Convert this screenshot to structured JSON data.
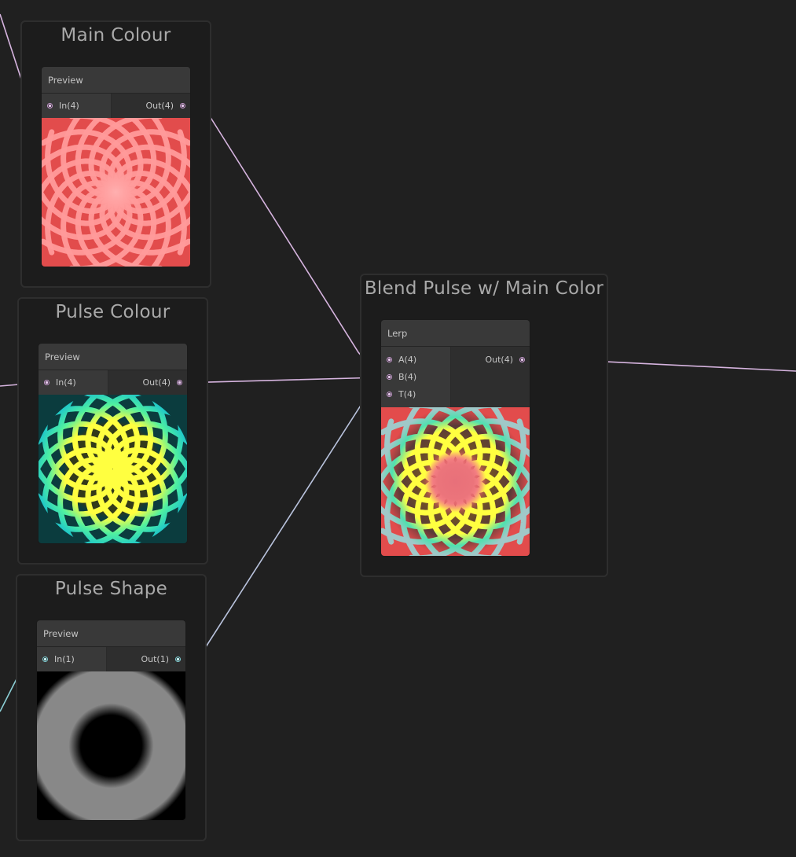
{
  "colors": {
    "background": "#202020",
    "wire_color4": "#d6b4df",
    "wire_float": "#8ccfd6",
    "main_red": "#e24c4c",
    "main_pink": "#ff9a9a",
    "pulse_yellow": "#ffff40",
    "pulse_cyan": "#20c8c8",
    "pulse_teal_bg": "#0b3c3e",
    "shape_gray": "#888888"
  },
  "groups": {
    "main_colour": {
      "title": "Main Colour",
      "node": {
        "header": "Preview",
        "input": "In(4)",
        "output": "Out(4)"
      }
    },
    "pulse_colour": {
      "title": "Pulse Colour",
      "node": {
        "header": "Preview",
        "input": "In(4)",
        "output": "Out(4)"
      }
    },
    "pulse_shape": {
      "title": "Pulse Shape",
      "node": {
        "header": "Preview",
        "input": "In(1)",
        "output": "Out(1)"
      }
    },
    "blend": {
      "title": "Blend Pulse w/ Main Color",
      "node": {
        "header": "Lerp",
        "input_a": "A(4)",
        "input_b": "B(4)",
        "input_t": "T(4)",
        "output": "Out(4)"
      }
    }
  }
}
